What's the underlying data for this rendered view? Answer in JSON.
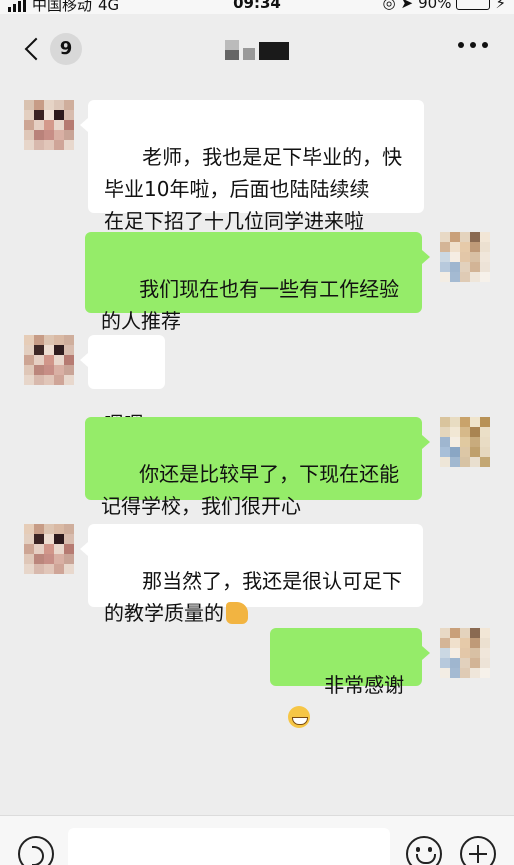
{
  "status_bar": {
    "carrier": "中国移动",
    "network": "4G",
    "time": "09:34",
    "battery": "90%",
    "battery_level": 0.9
  },
  "nav": {
    "back_icon": "chevron-left-icon",
    "unread_count": "9",
    "more_icon": "more-icon"
  },
  "messages": [
    {
      "side": "in",
      "text": "老师，我也是足下毕业的，快\n毕业10年啦，后面也陆陆续续\n在足下招了十几位同学进来啦"
    },
    {
      "side": "out",
      "text": "我们现在也有一些有工作经验\n的人推荐"
    },
    {
      "side": "in",
      "text": "嗯嗯"
    },
    {
      "side": "out",
      "text": "你还是比较早了，下现在还能\n记得学校，我们很开心"
    },
    {
      "side": "in",
      "text": "那当然了，我还是很认可足下\n的教学质量的",
      "emoji": "thumbs-up-icon"
    },
    {
      "side": "out",
      "text": "非常感谢",
      "emoji": "grin-icon"
    }
  ],
  "input_bar": {
    "voice_icon": "voice-icon",
    "input_value": "",
    "emoji_icon": "emoji-icon",
    "plus_icon": "plus-icon"
  },
  "colors": {
    "background": "#ededed",
    "bubble_out": "#95ec69",
    "bubble_in": "#ffffff"
  }
}
